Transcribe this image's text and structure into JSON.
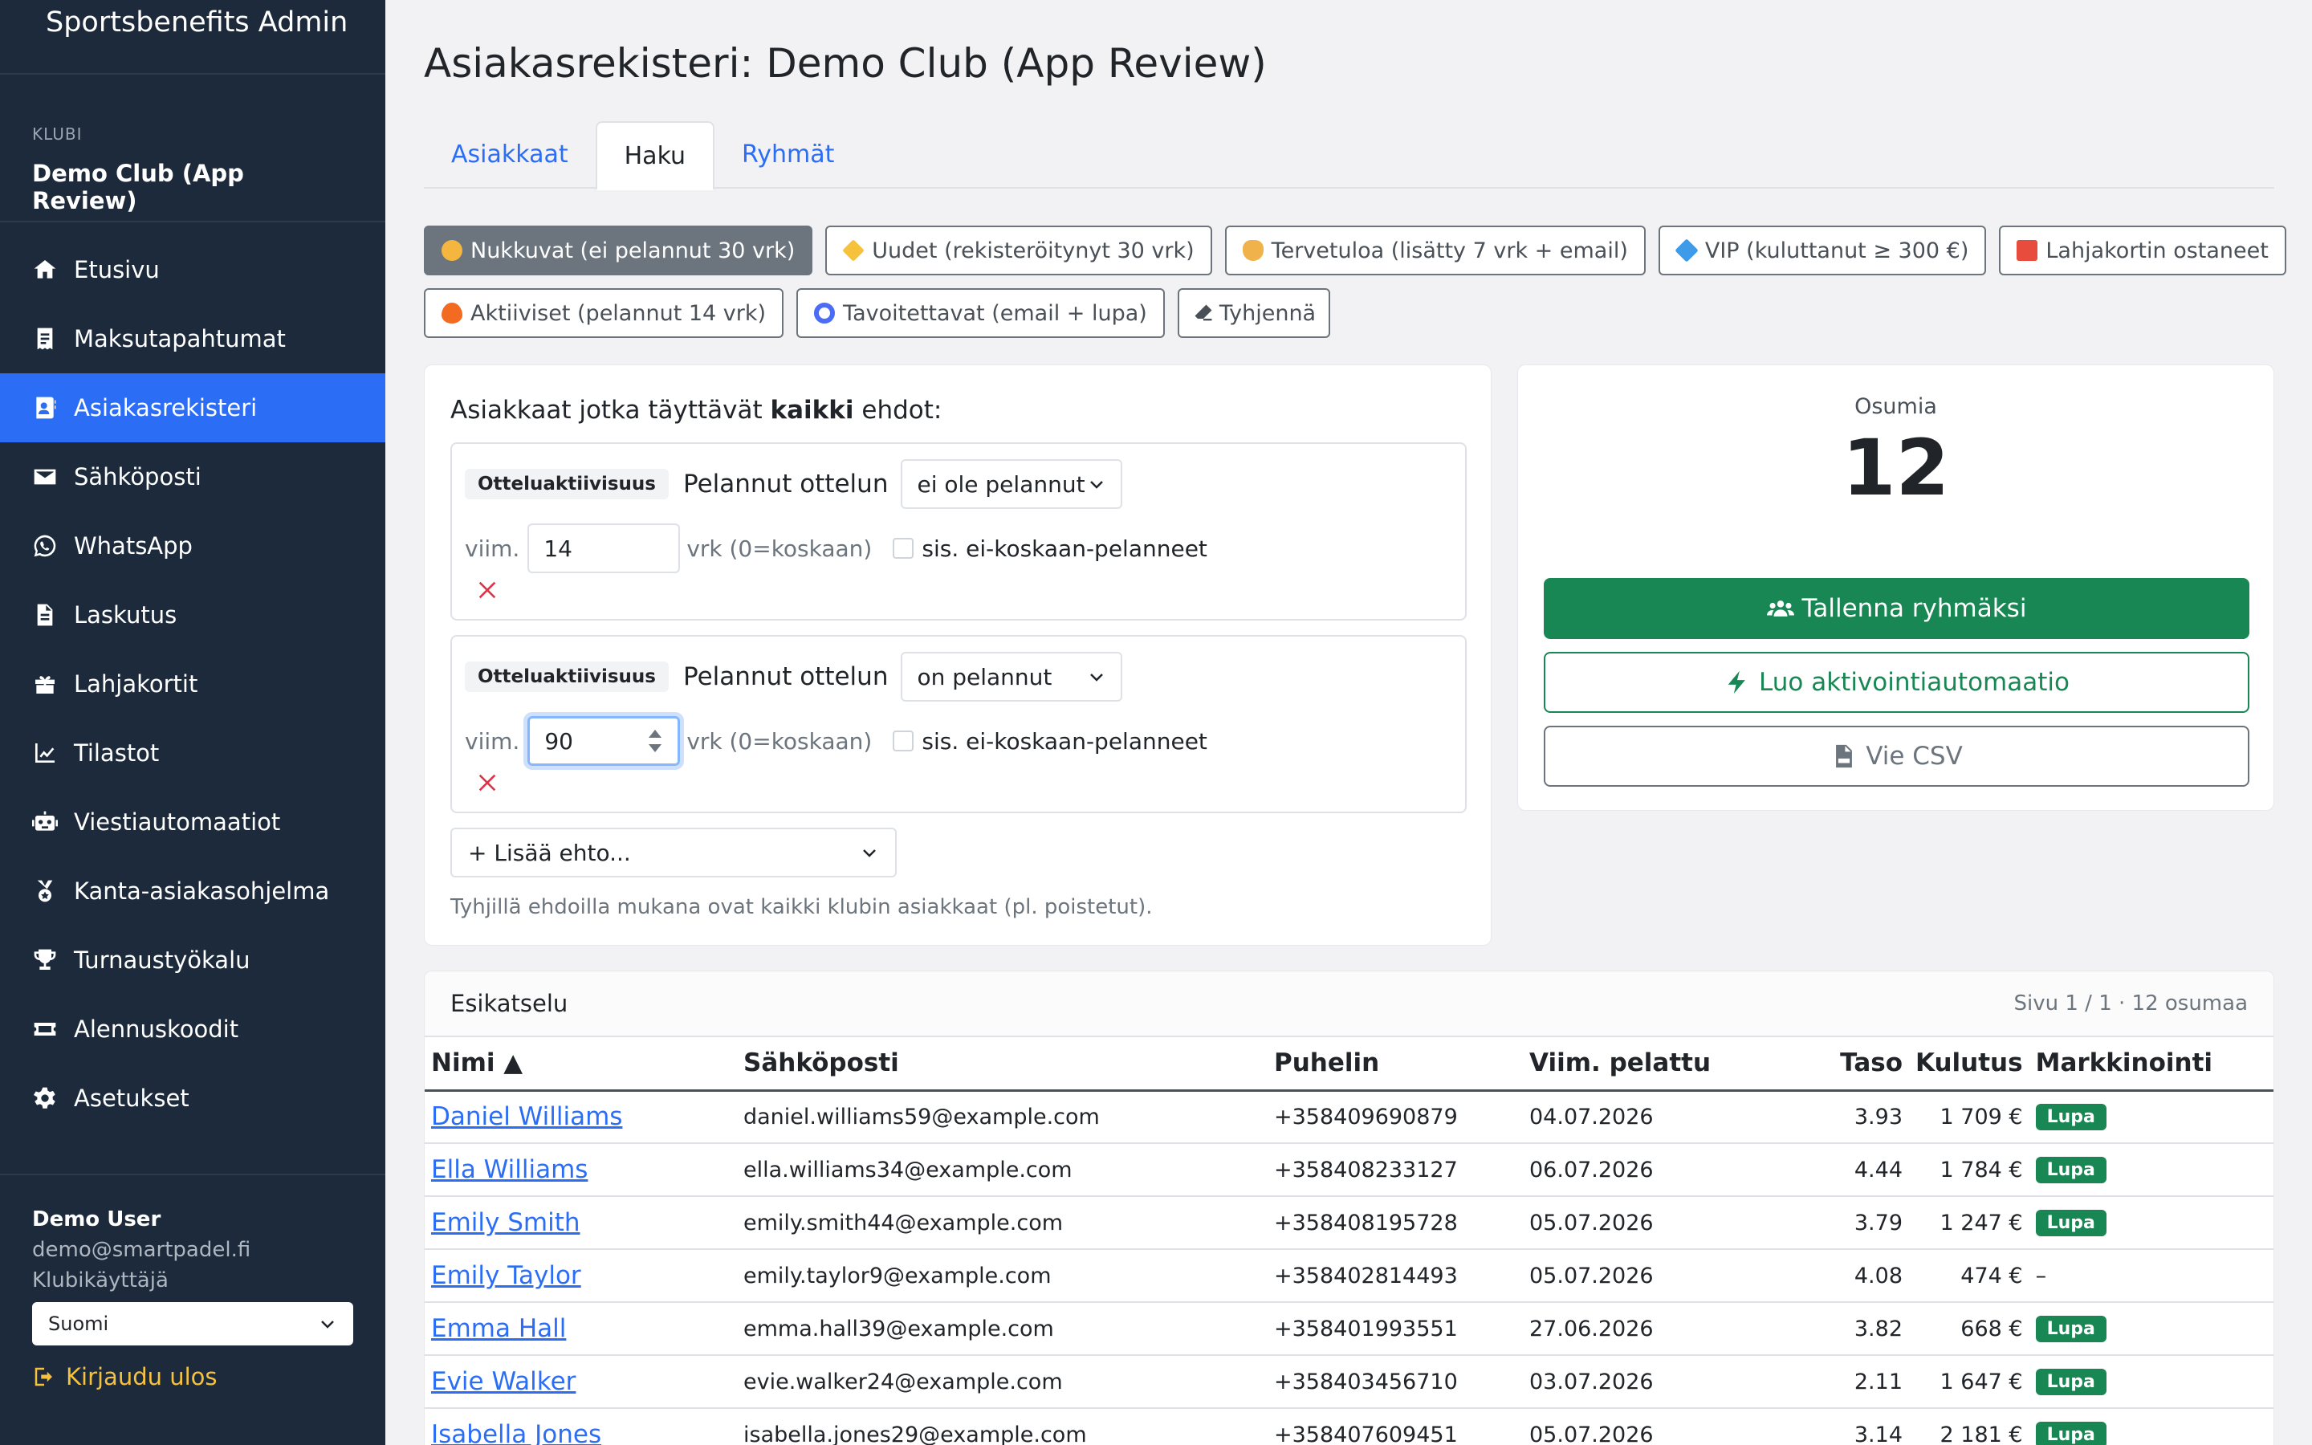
{
  "app": {
    "title": "Sportsbenefits Admin"
  },
  "club": {
    "caption": "KLUBI",
    "name": "Demo Club (App Review)"
  },
  "nav": [
    {
      "label": "Etusivu",
      "icon": "home-icon"
    },
    {
      "label": "Maksutapahtumat",
      "icon": "receipt-icon"
    },
    {
      "label": "Asiakasrekisteri",
      "icon": "contact-card-icon",
      "active": true
    },
    {
      "label": "Sähköposti",
      "icon": "envelope-icon"
    },
    {
      "label": "WhatsApp",
      "icon": "whatsapp-icon"
    },
    {
      "label": "Laskutus",
      "icon": "invoice-icon"
    },
    {
      "label": "Lahjakortit",
      "icon": "gift-icon"
    },
    {
      "label": "Tilastot",
      "icon": "chart-line-icon"
    },
    {
      "label": "Viestiautomaatiot",
      "icon": "robot-icon"
    },
    {
      "label": "Kanta-asiakasohjelma",
      "icon": "medal-icon"
    },
    {
      "label": "Turnaustyökalu",
      "icon": "trophy-icon"
    },
    {
      "label": "Alennuskoodit",
      "icon": "ticket-icon"
    },
    {
      "label": "Asetukset",
      "icon": "gear-icon"
    }
  ],
  "user": {
    "name": "Demo User",
    "email": "demo@smartpadel.fi",
    "role": "Klubikäyttäjä",
    "language": "Suomi",
    "logout": "Kirjaudu ulos"
  },
  "page": {
    "title": "Asiakasrekisteri: Demo Club (App Review)"
  },
  "tabs": [
    {
      "label": "Asiakkaat"
    },
    {
      "label": "Haku",
      "active": true
    },
    {
      "label": "Ryhmät"
    }
  ],
  "presets": {
    "row1": [
      {
        "label": "Nukkuvat (ei pelannut 30 vrk)",
        "active": true,
        "icon": "sleepy-face-icon",
        "color": "#f4b63f"
      },
      {
        "label": "Uudet (rekisteröitynyt 30 vrk)",
        "icon": "sparkles-icon",
        "color": "#f6c23e"
      },
      {
        "label": "Tervetuloa (lisätty 7 vrk + email)",
        "icon": "waving-hand-icon",
        "color": "#f0b24a"
      },
      {
        "label": "VIP (kuluttanut ≥ 300 €)",
        "icon": "gem-icon",
        "color": "#3d9be9"
      },
      {
        "label": "Lahjakortin ostaneet",
        "icon": "gift-box-icon",
        "color": "#e74c3c"
      }
    ],
    "row2": [
      {
        "label": "Aktiiviset (pelannut 14 vrk)",
        "icon": "fire-icon",
        "color": "#f36b21"
      },
      {
        "label": "Tavoitettavat (email + lupa)",
        "icon": "target-icon",
        "color": "#4a6cf7"
      },
      {
        "label": "Tyhjennä",
        "icon": "eraser-icon",
        "color": "#495057"
      }
    ]
  },
  "filter": {
    "title_pre": "Asiakkaat jotka täyttävät ",
    "title_bold": "kaikki",
    "title_post": " ehdot:",
    "conditions": [
      {
        "badge": "Otteluaktiivisuus",
        "label": "Pelannut ottelun",
        "mode": "ei ole pelannut",
        "prefix": "viim.",
        "days": "14",
        "suffix": "vrk (0=koskaan)",
        "checkbox_label": "sis. ei-koskaan-pelanneet"
      },
      {
        "badge": "Otteluaktiivisuus",
        "label": "Pelannut ottelun",
        "mode": "on pelannut",
        "prefix": "viim.",
        "days": "90",
        "suffix": "vrk (0=koskaan)",
        "checkbox_label": "sis. ei-koskaan-pelanneet"
      }
    ],
    "add_label": "+ Lisää ehto...",
    "hint": "Tyhjillä ehdoilla mukana ovat kaikki klubin asiakkaat (pl. poistetut)."
  },
  "result": {
    "label": "Osumia",
    "count": "12",
    "save_group": "Tallenna ryhmäksi",
    "create_automation": "Luo aktivointiautomaatio",
    "export_csv": "Vie CSV"
  },
  "preview": {
    "title": "Esikatselu",
    "pager": "Sivu 1 / 1 · 12 osumaa",
    "columns": [
      "Nimi ▲",
      "Sähköposti",
      "Puhelin",
      "Viim. pelattu",
      "Taso",
      "Kulutus",
      "Markkinointi"
    ],
    "rows": [
      {
        "name": "Daniel Williams",
        "email": "daniel.williams59@example.com",
        "phone": "+358409690879",
        "last": "04.07.2026",
        "level": "3.93",
        "spend": "1 709 €",
        "marketing": "Lupa"
      },
      {
        "name": "Ella Williams",
        "email": "ella.williams34@example.com",
        "phone": "+358408233127",
        "last": "06.07.2026",
        "level": "4.44",
        "spend": "1 784 €",
        "marketing": "Lupa"
      },
      {
        "name": "Emily Smith",
        "email": "emily.smith44@example.com",
        "phone": "+358408195728",
        "last": "05.07.2026",
        "level": "3.79",
        "spend": "1 247 €",
        "marketing": "Lupa"
      },
      {
        "name": "Emily Taylor",
        "email": "emily.taylor9@example.com",
        "phone": "+358402814493",
        "last": "05.07.2026",
        "level": "4.08",
        "spend": "474 €",
        "marketing": "–"
      },
      {
        "name": "Emma Hall",
        "email": "emma.hall39@example.com",
        "phone": "+358401993551",
        "last": "27.06.2026",
        "level": "3.82",
        "spend": "668 €",
        "marketing": "Lupa"
      },
      {
        "name": "Evie Walker",
        "email": "evie.walker24@example.com",
        "phone": "+358403456710",
        "last": "03.07.2026",
        "level": "2.11",
        "spend": "1 647 €",
        "marketing": "Lupa"
      },
      {
        "name": "Isabella Jones",
        "email": "isabella.jones29@example.com",
        "phone": "+358407609451",
        "last": "05.07.2026",
        "level": "3.14",
        "spend": "2 181 €",
        "marketing": "Lupa"
      }
    ]
  },
  "colors": {
    "sidebar": "#1c2a3b",
    "accent": "#2b6ef5",
    "success": "#198754",
    "secondary": "#6c757d"
  }
}
